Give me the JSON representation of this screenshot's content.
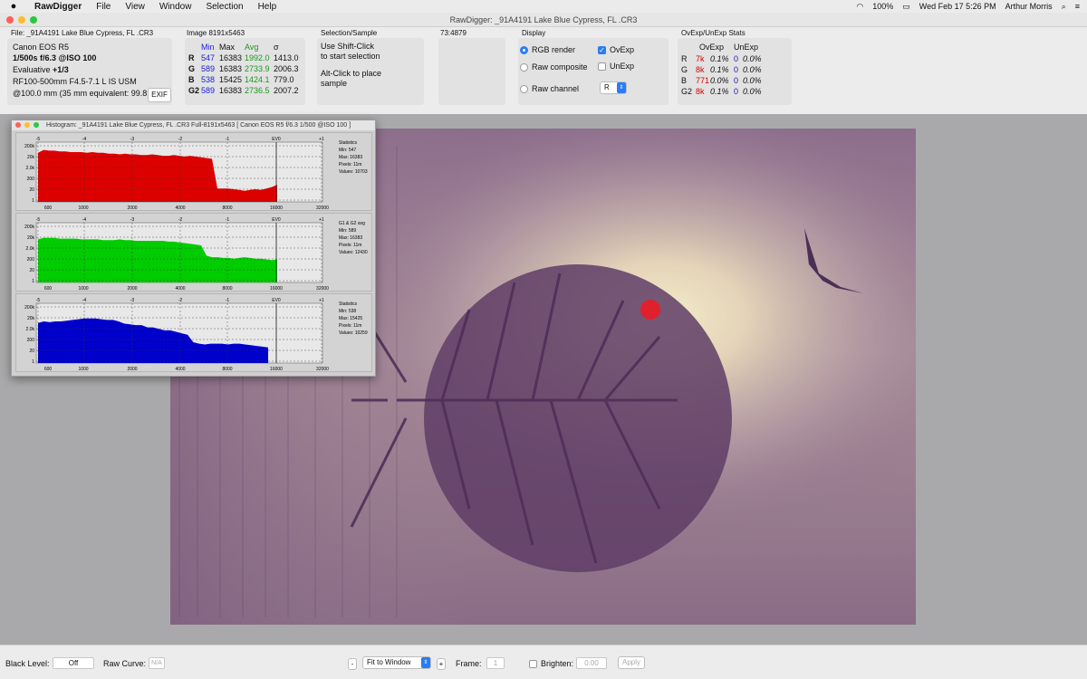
{
  "menubar": {
    "app": "RawDigger",
    "items": [
      "File",
      "View",
      "Window",
      "Selection",
      "Help"
    ],
    "battery": "100%",
    "datetime": "Wed Feb 17  5:26 PM",
    "user": "Arthur Morris"
  },
  "window": {
    "title": "RawDigger: _91A4191  Lake Blue Cypress, FL .CR3"
  },
  "file_info": {
    "label": "File: _91A4191  Lake Blue Cypress, FL .CR3",
    "camera": "Canon EOS R5",
    "exposure": "1/500s f/6.3 @ISO 100",
    "metering": "Evaluative",
    "metering_comp": "+1/3",
    "lens": "RF100-500mm F4.5-7.1 L IS USM",
    "focal": "@100.0 mm (35 mm equivalent: 99.8",
    "exif_button": "EXIF"
  },
  "image_stats": {
    "label": "Image 8191x5463",
    "headers": [
      "Min",
      "Max",
      "Avg",
      "σ"
    ],
    "rows": [
      {
        "ch": "R",
        "min": "547",
        "max": "16383",
        "avg": "1992.0",
        "sd": "1413.0"
      },
      {
        "ch": "G",
        "min": "589",
        "max": "16383",
        "avg": "2733.9",
        "sd": "2006.3"
      },
      {
        "ch": "B",
        "min": "538",
        "max": "15425",
        "avg": "1424.1",
        "sd": "779.0"
      },
      {
        "ch": "G2",
        "min": "589",
        "max": "16383",
        "avg": "2736.5",
        "sd": "2007.2"
      }
    ]
  },
  "selection": {
    "label": "Selection/Sample",
    "line1": "Use Shift-Click",
    "line2": "to start selection",
    "line3": "Alt-Click to place",
    "line4": "sample"
  },
  "coords": {
    "label": "73:4879"
  },
  "display": {
    "label": "Display",
    "rgb_render": "RGB render",
    "raw_composite": "Raw composite",
    "raw_channel": "Raw channel",
    "ovexp": "OvExp",
    "unexp": "UnExp",
    "channel_value": "R"
  },
  "ovexp_stats": {
    "label": "OvExp/UnExp Stats",
    "headers": [
      "OvExp",
      "UnExp"
    ],
    "rows": [
      {
        "ch": "R",
        "ov": "7k",
        "ovp": "0.1%",
        "un": "0",
        "unp": "0.0%"
      },
      {
        "ch": "G",
        "ov": "8k",
        "ovp": "0.1%",
        "un": "0",
        "unp": "0.0%"
      },
      {
        "ch": "B",
        "ov": "771",
        "ovp": "0.0%",
        "un": "0",
        "unp": "0.0%"
      },
      {
        "ch": "G2",
        "ov": "8k",
        "ovp": "0.1%",
        "un": "0",
        "unp": "0.0%"
      }
    ]
  },
  "histogram": {
    "title": "Histogram: _91A4191  Lake Blue Cypress, FL .CR3 Full-8191x5463 [ Canon EOS R5 f/6.3 1/500 @ISO 100 ]",
    "ev_ticks": [
      "-5",
      "-4",
      "-3",
      "-2",
      "-1",
      "EV0",
      "+1"
    ],
    "x_ticks": [
      "600",
      "1000",
      "2000",
      "4000",
      "8000",
      "16000",
      "32000"
    ],
    "y_ticks": [
      "200k",
      "20k",
      "2.0k",
      "200",
      "20",
      "1"
    ],
    "panels": [
      {
        "color": "#dd0000",
        "stats": [
          "Statistics",
          "Min: 547",
          "Max: 16383",
          "Pixels: 11m",
          "Values: 10703"
        ]
      },
      {
        "color": "#00cc00",
        "stats": [
          "G1 & G2 avg",
          "Min: 589",
          "Max: 16383",
          "Pixels: 11m",
          "Values: 12430"
        ]
      },
      {
        "color": "#0000cc",
        "stats": [
          "Statistics",
          "Min: 538",
          "Max: 15425",
          "Pixels: 11m",
          "Values: 10259"
        ]
      }
    ]
  },
  "bottom": {
    "black_level_label": "Black Level:",
    "black_level_value": "Off",
    "raw_curve_label": "Raw Curve:",
    "raw_curve_value": "N/A",
    "minus": "-",
    "fit": "Fit to Window",
    "plus": "+",
    "frame_label": "Frame:",
    "frame_value": "1",
    "brighten_label": "Brighten:",
    "brighten_value": "0.00",
    "apply": "Apply"
  }
}
